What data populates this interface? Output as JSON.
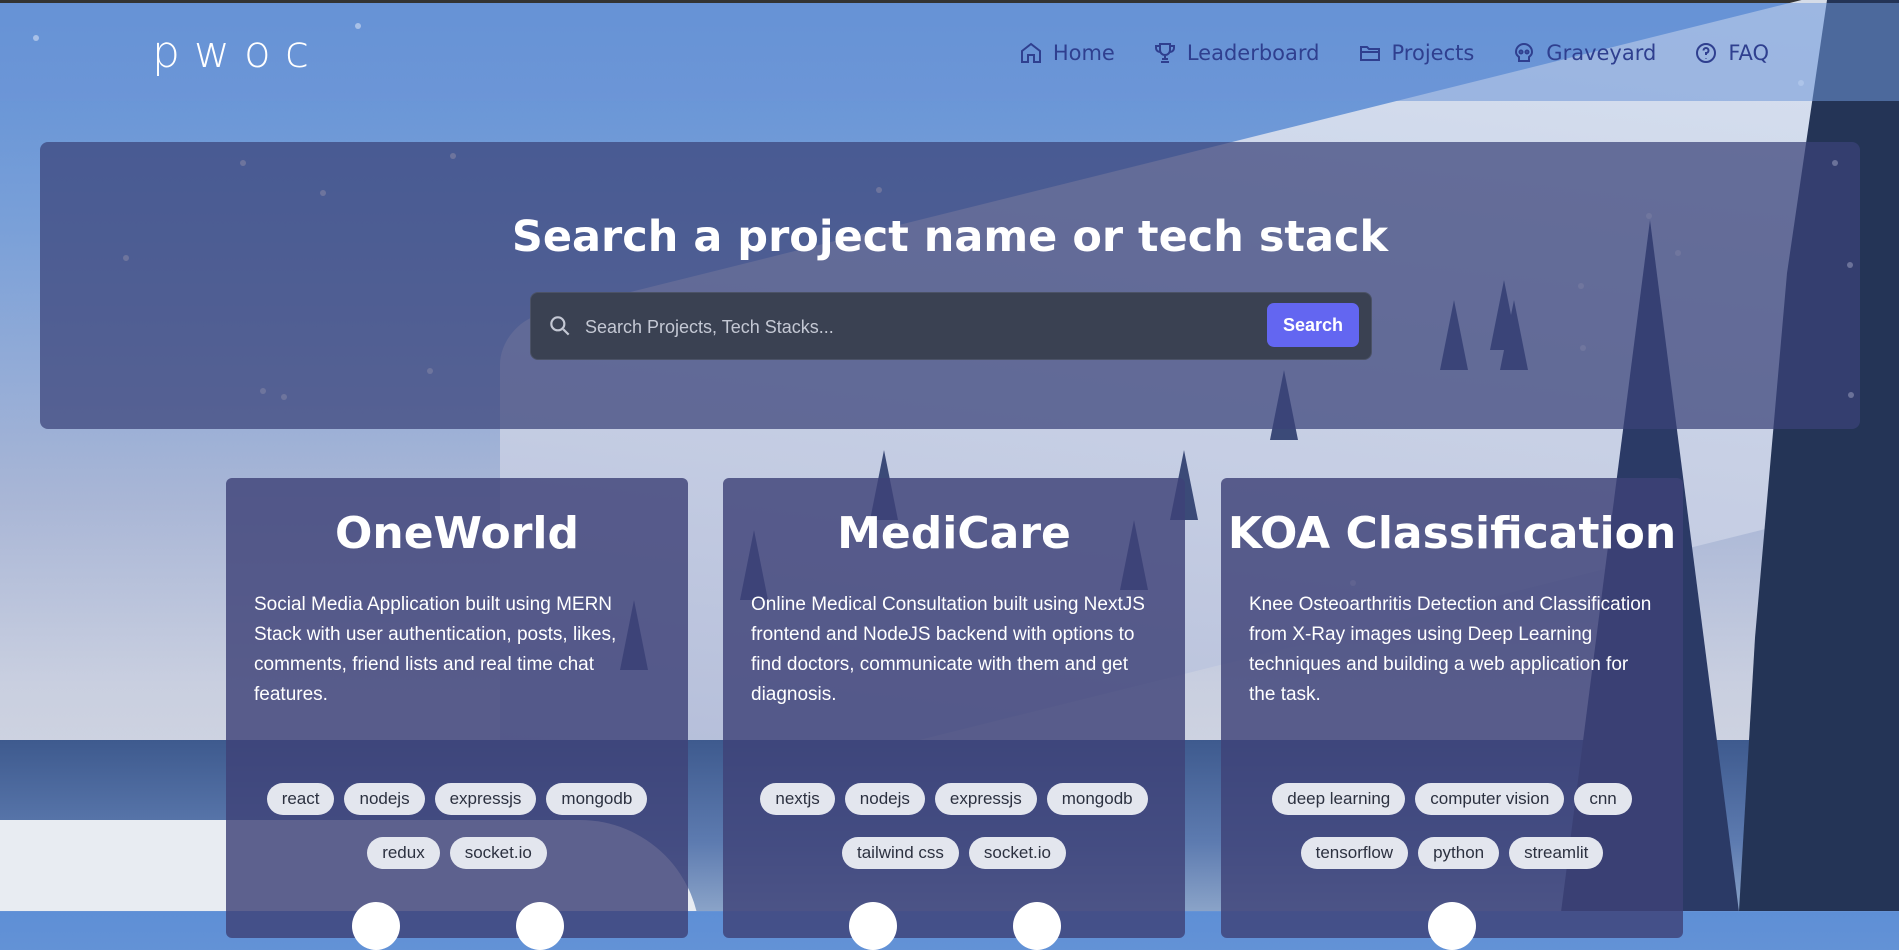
{
  "brand": {
    "logo": "pwoc"
  },
  "nav": {
    "items": [
      {
        "label": "Home",
        "icon": "home-icon"
      },
      {
        "label": "Leaderboard",
        "icon": "trophy-icon"
      },
      {
        "label": "Projects",
        "icon": "folder-icon"
      },
      {
        "label": "Graveyard",
        "icon": "skull-icon"
      },
      {
        "label": "FAQ",
        "icon": "question-circle-icon"
      }
    ]
  },
  "search": {
    "title": "Search a project name or tech stack",
    "placeholder": "Search Projects, Tech Stacks...",
    "value": "",
    "button_label": "Search"
  },
  "colors": {
    "accent": "#6366f1",
    "nav_text": "#2f3f8f"
  },
  "projects": [
    {
      "title": "OneWorld",
      "description": "Social Media Application built using MERN Stack with user authentication, posts, likes, comments, friend lists and real time chat features.",
      "tags": [
        "react",
        "nodejs",
        "expressjs",
        "mongodb",
        "redux",
        "socket.io"
      ]
    },
    {
      "title": "MediCare",
      "description": "Online Medical Consultation built using NextJS frontend and NodeJS backend with options to find doctors, communicate with them and get diagnosis.",
      "tags": [
        "nextjs",
        "nodejs",
        "expressjs",
        "mongodb",
        "tailwind css",
        "socket.io"
      ]
    },
    {
      "title": "KOA Classification",
      "description": "Knee Osteoarthritis Detection and Classification from X-Ray images using Deep Learning techniques and building a web application for the task.",
      "tags": [
        "deep learning",
        "computer vision",
        "cnn",
        "tensorflow",
        "python",
        "streamlit"
      ]
    }
  ]
}
